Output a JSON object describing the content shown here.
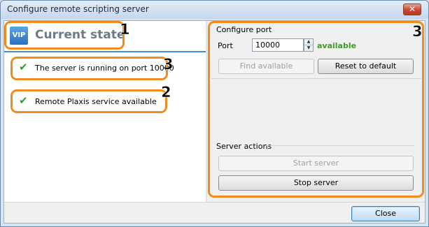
{
  "window": {
    "title": "Configure remote scripting server",
    "close_glyph": "✕"
  },
  "left_panel": {
    "icon_text": "VIP",
    "heading": "Current state",
    "statuses": [
      {
        "icon": "check-icon",
        "glyph": "✔",
        "text": "The server is running on port 10000"
      },
      {
        "icon": "check-icon",
        "glyph": "✔",
        "text": "Remote Plaxis service available"
      }
    ]
  },
  "configure_port": {
    "section_label": "Configure port",
    "port_label": "Port",
    "port_value": "10000",
    "availability": "available",
    "find_available_label": "Find available",
    "reset_default_label": "Reset to default"
  },
  "server_actions": {
    "section_label": "Server actions",
    "start_label": "Start server",
    "stop_label": "Stop server"
  },
  "footer": {
    "close_label": "Close"
  },
  "annotations": [
    "1",
    "3",
    "2",
    "3"
  ],
  "colors": {
    "annotation": "#f08c1e",
    "available": "#3d9b27",
    "check": "#2e9e2e",
    "heading_rule": "#3e8fd8"
  }
}
